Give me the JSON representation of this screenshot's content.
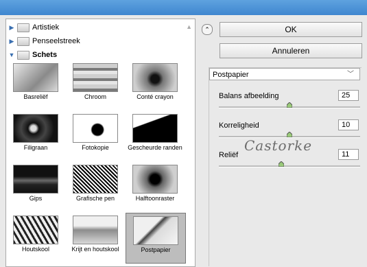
{
  "categories": [
    {
      "label": "Artistiek",
      "open": false
    },
    {
      "label": "Penseelstreek",
      "open": false
    },
    {
      "label": "Schets",
      "open": true
    }
  ],
  "thumbnails": [
    {
      "label": "Basreliëf"
    },
    {
      "label": "Chroom"
    },
    {
      "label": "Conté crayon"
    },
    {
      "label": "Filigraan"
    },
    {
      "label": "Fotokopie"
    },
    {
      "label": "Gescheurde randen"
    },
    {
      "label": "Gips"
    },
    {
      "label": "Grafische pen"
    },
    {
      "label": "Halftoonraster"
    },
    {
      "label": "Houtskool"
    },
    {
      "label": "Krijt en houtskool"
    },
    {
      "label": "Postpapier",
      "selected": true
    }
  ],
  "buttons": {
    "ok": "OK",
    "cancel": "Annuleren"
  },
  "filter": {
    "selected": "Postpapier"
  },
  "params": [
    {
      "label": "Balans afbeelding",
      "value": "25",
      "fraction": 0.5
    },
    {
      "label": "Korreligheid",
      "value": "10",
      "fraction": 0.5
    },
    {
      "label": "Reliëf",
      "value": "11",
      "fraction": 0.44
    }
  ],
  "watermark": "Castorke",
  "icons": {
    "collapse": "double-chevron-up-icon",
    "folder": "folder-icon",
    "expand": "triangle-icon",
    "dropdown": "chevron-down-icon"
  }
}
